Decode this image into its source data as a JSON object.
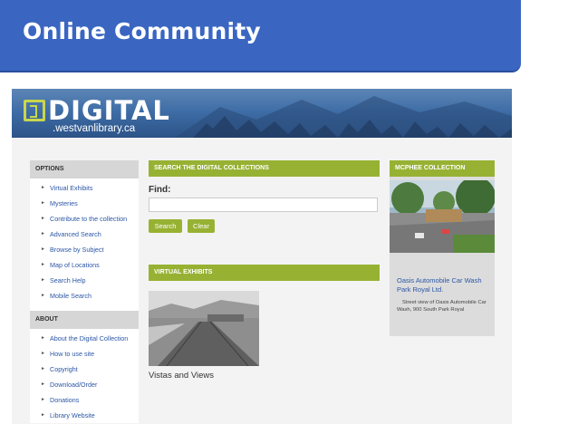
{
  "slide": {
    "title": "Online Community"
  },
  "site": {
    "logo": {
      "name": "DIGITAL",
      "subdomain": ".westvanlibrary.ca"
    },
    "options": {
      "heading": "OPTIONS",
      "items": [
        "Virtual Exhibits",
        "Mysteries",
        "Contribute to the collection",
        "Advanced Search",
        "Browse by Subject",
        "Map of Locations",
        "Search Help",
        "Mobile Search"
      ]
    },
    "about": {
      "heading": "ABOUT",
      "items": [
        "About the Digital Collection",
        "How to use site",
        "Copyright",
        "Download/Order",
        "Donations",
        "Library Website"
      ]
    },
    "search": {
      "heading": "SEARCH THE DIGITAL COLLECTIONS",
      "find_label": "Find:",
      "input_value": "",
      "search_button": "Search",
      "clear_button": "Clear"
    },
    "virtual_exhibits": {
      "heading": "VIRTUAL EXHIBITS",
      "caption": "Vistas and Views"
    },
    "mcphee": {
      "heading": "MCPHEE COLLECTION",
      "title": "Oasis Automobile Car Wash Park Royal Ltd.",
      "description": "Street view of Oasis Automobile Car Wash, 900 South Park Royal"
    },
    "colors": {
      "accent_green": "#97b233",
      "link_blue": "#2c57a6",
      "title_blue": "#3a66c2"
    }
  }
}
